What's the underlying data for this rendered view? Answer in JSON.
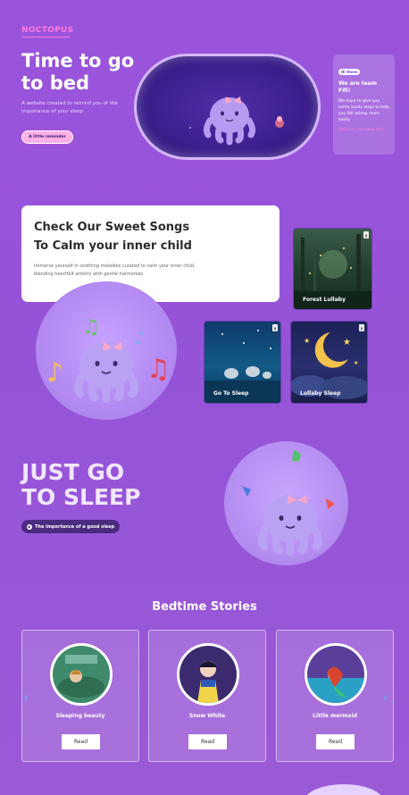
{
  "brand": {
    "logo": "NOCTOPUS"
  },
  "hero": {
    "title": "Time to go to bed",
    "subtitle": "A website created to remind you of the importance of your sleep",
    "button_label": "A little reminder"
  },
  "info_card": {
    "tag": "Hi there",
    "title": "We are team Fifi!",
    "body": "We hope to give you some lovely ways to help you fall asleep more easily",
    "link": "Ideas fun, and sleep well"
  },
  "songs": {
    "title_line1": "Check Our Sweet Songs",
    "title_line2": "To Calm your inner child",
    "description": "Immerse yourself in soothing melodies curated to calm your inner child, blending heartfelt artistry with gentle harmonies",
    "cards": [
      {
        "label": "Forest Lullaby"
      },
      {
        "label": "Go To Sleep"
      },
      {
        "label": "Lullaby Sleep"
      }
    ]
  },
  "sleep": {
    "title": "JUST GO TO SLEEP",
    "button_label": "The importance of a good sleep"
  },
  "stories": {
    "title": "Bedtime Stories",
    "items": [
      {
        "name": "Sleeping beauty",
        "read_label": "Read"
      },
      {
        "name": "Snow White",
        "read_label": "Read"
      },
      {
        "name": "Little mermaid",
        "read_label": "Read"
      }
    ],
    "prev_icon": "chevron-left-icon",
    "next_icon": "chevron-right-icon"
  },
  "colors": {
    "background": "#9a54dc",
    "accent_pink": "#ff79e0",
    "arrow_blue": "#4aa4ff"
  }
}
